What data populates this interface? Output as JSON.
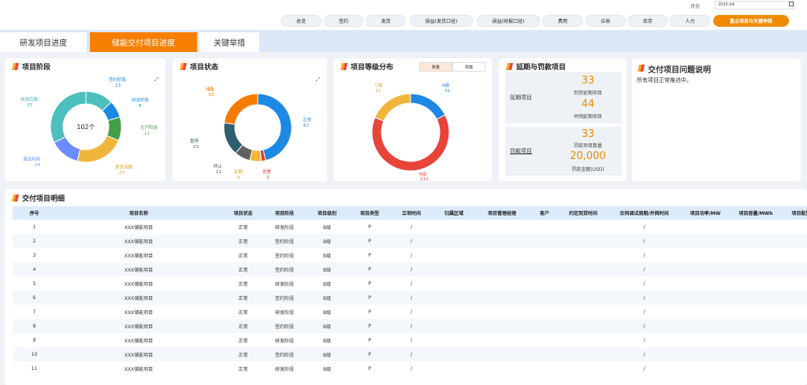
{
  "header": {
    "month_label": "月份",
    "month_value": "2025-04",
    "nav": [
      "总览",
      "签约",
      "发货",
      "损益(发货口径)",
      "损益(财报口径)",
      "费用",
      "应收",
      "库存",
      "人力"
    ],
    "highlight": "重点项目与关键举措"
  },
  "tabs": [
    "研发项目进度",
    "储能交付项目进度",
    "关键举措"
  ],
  "active_tab_index": 1,
  "stage_card": {
    "title": "项目阶段",
    "center": "102个",
    "labels": [
      {
        "name": "签约阶段",
        "value": "13"
      },
      {
        "name": "研发阶段",
        "value": "8"
      },
      {
        "name": "生产阶段",
        "value": "11"
      },
      {
        "name": "发货运输",
        "value": "23"
      },
      {
        "name": "调试并网",
        "value": "14"
      },
      {
        "name": "并网完成",
        "value": "33"
      }
    ]
  },
  "status_card": {
    "title": "项目状态",
    "labels": [
      {
        "name": "正常",
        "value": "67"
      },
      {
        "name": "告警",
        "value": "3"
      },
      {
        "name": "延期",
        "value": "8"
      },
      {
        "name": "终止",
        "value": "11"
      },
      {
        "name": "暂停",
        "value": "23"
      },
      {
        "name": "储备",
        "value": "33"
      }
    ]
  },
  "grade_card": {
    "title": "项目等级分布",
    "seg_qty": "数量",
    "seg_scale": "规模",
    "labels": [
      {
        "name": "A级",
        "value": "31"
      },
      {
        "name": "B级",
        "value": "112"
      },
      {
        "name": "C级",
        "value": "33"
      }
    ]
  },
  "delay_card": {
    "title": "延期与罚款项目",
    "delay_label": "延期项目",
    "delay_due_value": "33",
    "delay_due_label": "到货延期项目",
    "delay_grid_value": "44",
    "delay_grid_label": "并网延期项目",
    "penalty_label": "罚款项目",
    "penalty_count_value": "33",
    "penalty_count_label": "罚款项目数量",
    "penalty_amount_value": "20,000",
    "penalty_amount_label": "罚款金额(USD)"
  },
  "issue_card": {
    "title": "交付项目问题说明",
    "text": "所有项目正常推进中。"
  },
  "detail": {
    "title": "交付项目明细",
    "columns": [
      "序号",
      "项目名称",
      "项目状态",
      "项目阶段",
      "项目级别",
      "项目类型",
      "立项时间",
      "归属区域",
      "项目管理经理",
      "客户",
      "约定到货时间",
      "合同调试周期/并网时间",
      "项目功率/MW",
      "项目容量/MWh",
      "项目配置"
    ],
    "rows": [
      [
        "1",
        "XXX储能项目",
        "正常",
        "研发阶段",
        "B级",
        "P",
        "/",
        "",
        "",
        "",
        "",
        "/",
        "",
        "",
        ""
      ],
      [
        "2",
        "XXX储能项目",
        "正常",
        "签约阶段",
        "B级",
        "P",
        "/",
        "",
        "",
        "",
        "",
        "/",
        "",
        "",
        ""
      ],
      [
        "3",
        "XXX储能项目",
        "正常",
        "签约阶段",
        "B级",
        "P",
        "/",
        "",
        "",
        "",
        "",
        "/",
        "",
        "",
        ""
      ],
      [
        "4",
        "XXX储能项目",
        "正常",
        "签约阶段",
        "B级",
        "P",
        "/",
        "",
        "",
        "",
        "",
        "/",
        "",
        "",
        ""
      ],
      [
        "5",
        "XXX储能项目",
        "正常",
        "研发阶段",
        "B级",
        "P",
        "/",
        "",
        "",
        "",
        "",
        "/",
        "",
        "",
        ""
      ],
      [
        "6",
        "XXX储能项目",
        "正常",
        "签约阶段",
        "B级",
        "P",
        "/",
        "",
        "",
        "",
        "",
        "/",
        "",
        "",
        ""
      ],
      [
        "7",
        "XXX储能项目",
        "正常",
        "研发阶段",
        "B级",
        "P",
        "/",
        "",
        "",
        "",
        "",
        "/",
        "",
        "",
        ""
      ],
      [
        "8",
        "XXX储能项目",
        "正常",
        "签约阶段",
        "B级",
        "P",
        "/",
        "",
        "",
        "",
        "",
        "/",
        "",
        "",
        ""
      ],
      [
        "9",
        "XXX储能项目",
        "正常",
        "研发阶段",
        "B级",
        "P",
        "/",
        "",
        "",
        "",
        "",
        "/",
        "",
        "",
        ""
      ],
      [
        "10",
        "XXX储能项目",
        "正常",
        "签约阶段",
        "B级",
        "P",
        "/",
        "",
        "",
        "",
        "",
        "/",
        "",
        "",
        ""
      ],
      [
        "11",
        "XXX储能项目",
        "正常",
        "研发阶段",
        "B级",
        "P",
        "/",
        "",
        "",
        "",
        "",
        "/",
        "",
        "",
        ""
      ]
    ]
  },
  "chart_data": [
    {
      "type": "pie",
      "title": "项目阶段",
      "categories": [
        "签约阶段",
        "研发阶段",
        "生产阶段",
        "发货运输",
        "调试并网",
        "并网完成"
      ],
      "values": [
        13,
        8,
        11,
        23,
        14,
        33
      ],
      "colors": [
        "#4dbfbf",
        "#1e88e5",
        "#43a047",
        "#f0b63c",
        "#6b8cff",
        "#4dbfbf"
      ]
    },
    {
      "type": "pie",
      "title": "项目状态",
      "categories": [
        "正常",
        "告警",
        "延期",
        "终止",
        "暂停",
        "储备"
      ],
      "values": [
        67,
        3,
        8,
        11,
        23,
        33
      ],
      "colors": [
        "#1e88e5",
        "#e53935",
        "#f0b63c",
        "#616161",
        "#2f5f6e",
        "#f57c00"
      ]
    },
    {
      "type": "pie",
      "title": "项目等级分布",
      "categories": [
        "A级",
        "B级",
        "C级"
      ],
      "values": [
        31,
        112,
        33
      ],
      "colors": [
        "#1e88e5",
        "#e8443a",
        "#f0b63c"
      ]
    }
  ],
  "colors": {
    "accent": "#f08a00",
    "tab_active": "#f77f00",
    "header_row": "#dcebf9"
  }
}
